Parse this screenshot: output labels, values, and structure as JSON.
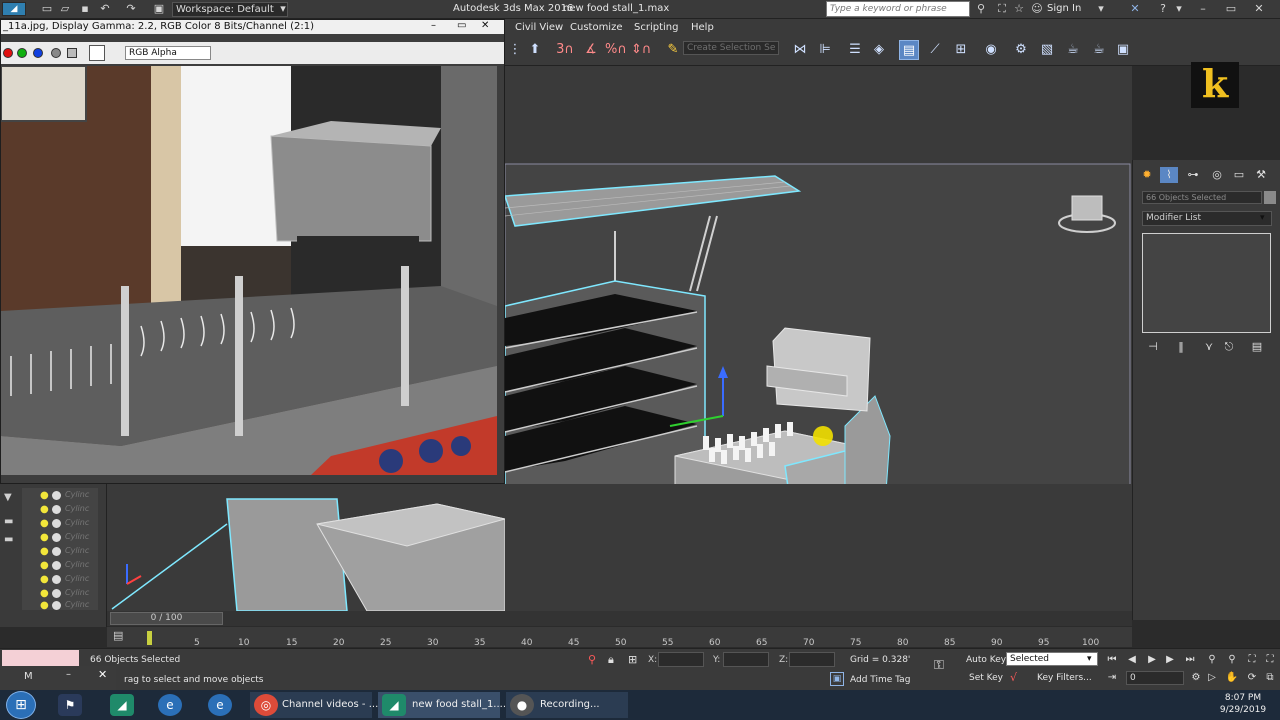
{
  "app": {
    "title": "Autodesk 3ds Max 2016",
    "file": "new food stall_1.max",
    "workspace": "Workspace: Default",
    "search_placeholder": "Type a keyword or phrase",
    "sign_in": "Sign In"
  },
  "menu": {
    "items": [
      "Civil View",
      "Customize",
      "Scripting",
      "Help"
    ]
  },
  "toolbar": {
    "selection_set_placeholder": "Create Selection Se"
  },
  "frame_buffer": {
    "title": "_11a.jpg, Display Gamma: 2.2, RGB Color 8 Bits/Channel (2:1)",
    "channel": "RGB Alpha"
  },
  "explorer": {
    "rows": [
      "Cylinc",
      "Cylinc",
      "Cylinc",
      "Cylinc",
      "Cylinc",
      "Cylinc",
      "Cylinc",
      "Cylinc",
      "Cylinc"
    ]
  },
  "command_panel": {
    "selection": "66 Objects Selected",
    "modifier_list": "Modifier List"
  },
  "time": {
    "slider": "0 / 100",
    "ticks": [
      "5",
      "10",
      "15",
      "20",
      "25",
      "30",
      "35",
      "40",
      "45",
      "50",
      "55",
      "60",
      "65",
      "70",
      "75",
      "80",
      "85",
      "90",
      "95",
      "100"
    ]
  },
  "status": {
    "selection": "66 Objects Selected",
    "prompt": "rag to select and move objects",
    "x": "X:",
    "y": "Y:",
    "z": "Z:",
    "grid": "Grid = 0.328'",
    "add_time_tag": "Add Time Tag",
    "auto_key": "Auto Key",
    "set_key": "Set Key",
    "key_mode": "Selected",
    "key_filters": "Key Filters...",
    "frame": "0"
  },
  "taskbar": {
    "chrome_task": "Channel videos - ...",
    "max_task": "new food stall_1....",
    "recording_task": "Recording...",
    "mini_label": "M",
    "time": "8:07 PM",
    "date": "9/29/2019"
  },
  "logo": {
    "letter": "k"
  },
  "colors": {
    "accent": "#5b87c4",
    "selection_outline": "#7fe8ff",
    "logo_yellow": "#f0c020"
  }
}
